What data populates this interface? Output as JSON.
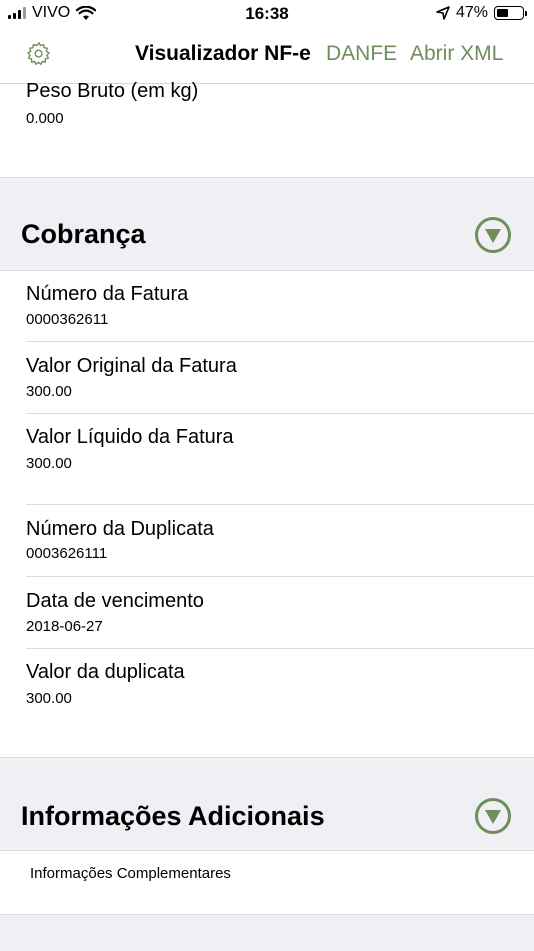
{
  "status_bar": {
    "carrier": "VIVO",
    "time": "16:38",
    "battery": "47%"
  },
  "nav": {
    "title": "Visualizador NF-e",
    "danfe": "DANFE",
    "abrir_xml": "Abrir XML"
  },
  "top_row": {
    "label": "Peso Bruto (em kg)",
    "value": "0.000"
  },
  "cobranca": {
    "title": "Cobrança",
    "rows": [
      {
        "label": "Número da Fatura",
        "value": "0000362611"
      },
      {
        "label": "Valor Original da Fatura",
        "value": "300.00"
      },
      {
        "label": "Valor Líquido da Fatura",
        "value": "300.00"
      },
      {
        "label": "Número da Duplicata",
        "value": "0003626111"
      },
      {
        "label": "Data de vencimento",
        "value": "2018-06-27"
      },
      {
        "label": "Valor da duplicata",
        "value": "300.00"
      }
    ]
  },
  "informacoes": {
    "title": "Informações Adicionais",
    "row": "Informações Complementares"
  },
  "colors": {
    "accent": "#6e8f5c",
    "section_bg": "#efeff4"
  }
}
